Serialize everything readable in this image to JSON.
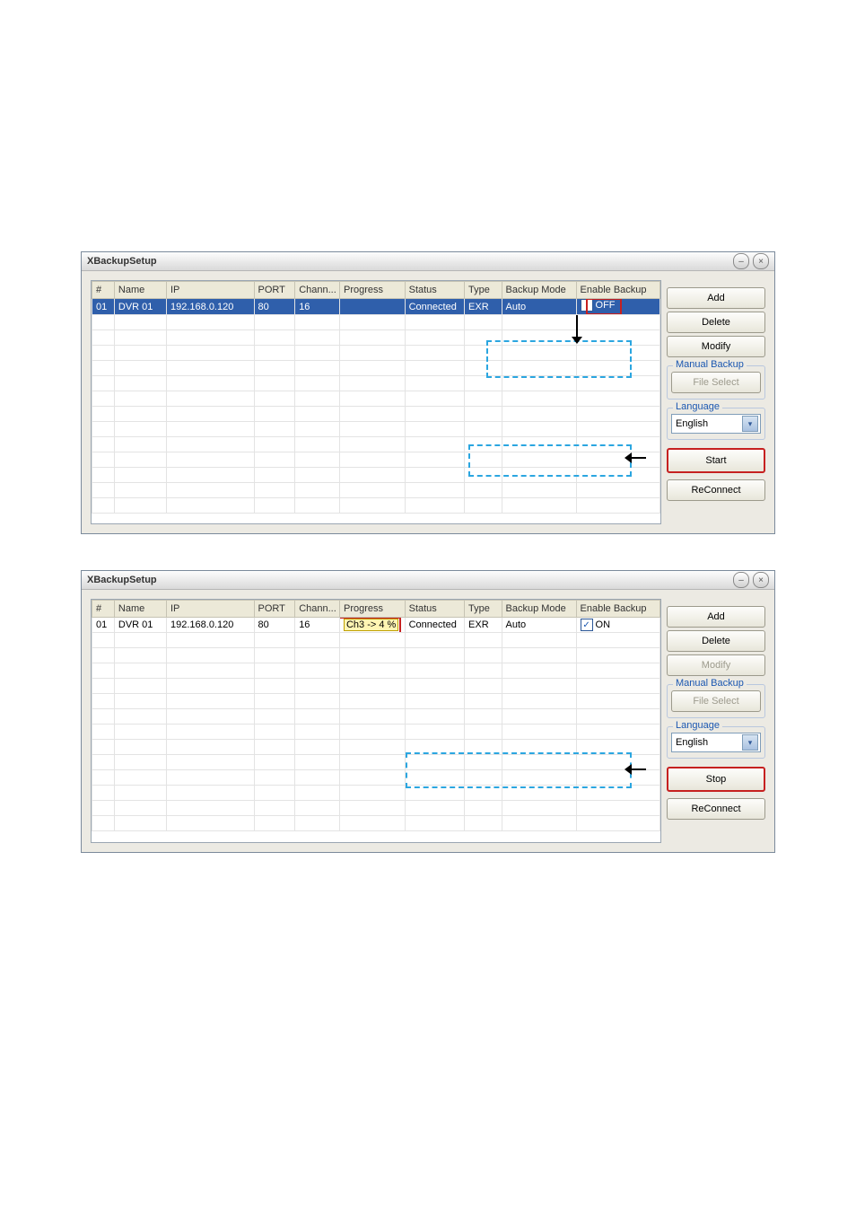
{
  "app_title": "XBackupSetup",
  "window_buttons": {
    "minimize": "–",
    "close": "×"
  },
  "columns": {
    "num": "#",
    "name": "Name",
    "ip": "IP",
    "port": "PORT",
    "chan": "Chann...",
    "progress": "Progress",
    "status": "Status",
    "type": "Type",
    "mode": "Backup Mode",
    "enable": "Enable Backup"
  },
  "panel1": {
    "row": {
      "num": "01",
      "name": "DVR 01",
      "ip": "192.168.0.120",
      "port": "80",
      "chan": "16",
      "progress": "",
      "status": "Connected",
      "type": "EXR",
      "mode": "Auto",
      "enable_label": "OFF",
      "enable_checked": false
    },
    "buttons": {
      "add": "Add",
      "delete": "Delete",
      "modify": "Modify",
      "manual": "Manual Backup",
      "file_select": "File Select",
      "lang_group": "Language",
      "lang_value": "English",
      "start": "Start",
      "reconnect": "ReConnect"
    }
  },
  "panel2": {
    "row": {
      "num": "01",
      "name": "DVR 01",
      "ip": "192.168.0.120",
      "port": "80",
      "chan": "16",
      "progress": "Ch3 -> 4 %",
      "status": "Connected",
      "type": "EXR",
      "mode": "Auto",
      "enable_label": "ON",
      "enable_checked": true
    },
    "buttons": {
      "add": "Add",
      "delete": "Delete",
      "modify": "Modify",
      "manual": "Manual Backup",
      "file_select": "File Select",
      "lang_group": "Language",
      "lang_value": "English",
      "stop": "Stop",
      "reconnect": "ReConnect"
    }
  }
}
